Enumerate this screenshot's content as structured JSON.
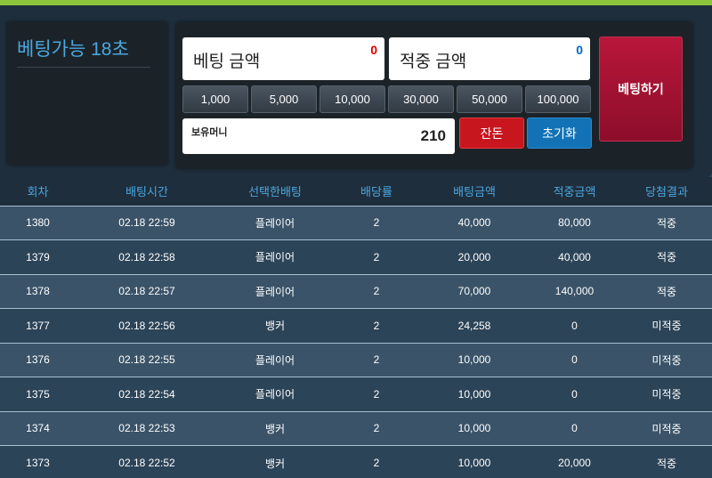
{
  "timer": {
    "label": "베팅가능 18초"
  },
  "bet_amount": {
    "label": "베팅 금액",
    "value": "0",
    "color": "#e00000"
  },
  "win_amount": {
    "label": "적중 금액",
    "value": "0",
    "color": "#0066cc"
  },
  "chips": [
    "1,000",
    "5,000",
    "10,000",
    "30,000",
    "50,000",
    "100,000"
  ],
  "money": {
    "label": "보유머니",
    "value": "210"
  },
  "buttons": {
    "change": "잔돈",
    "reset": "초기화",
    "bet": "베팅하기"
  },
  "table": {
    "headers": [
      "회차",
      "배팅시간",
      "선택한배팅",
      "배당률",
      "배팅금액",
      "적중금액",
      "당첨결과"
    ],
    "rows": [
      {
        "round": "1380",
        "time": "02.18 22:59",
        "choice": "플레이어",
        "odds": "2",
        "bet": "40,000",
        "win": "80,000",
        "result": "적중",
        "status": "win"
      },
      {
        "round": "1379",
        "time": "02.18 22:58",
        "choice": "플레이어",
        "odds": "2",
        "bet": "20,000",
        "win": "40,000",
        "result": "적중",
        "status": "win"
      },
      {
        "round": "1378",
        "time": "02.18 22:57",
        "choice": "플레이어",
        "odds": "2",
        "bet": "70,000",
        "win": "140,000",
        "result": "적중",
        "status": "win"
      },
      {
        "round": "1377",
        "time": "02.18 22:56",
        "choice": "뱅커",
        "odds": "2",
        "bet": "24,258",
        "win": "0",
        "result": "미적중",
        "status": "lose"
      },
      {
        "round": "1376",
        "time": "02.18 22:55",
        "choice": "플레이어",
        "odds": "2",
        "bet": "10,000",
        "win": "0",
        "result": "미적중",
        "status": "lose"
      },
      {
        "round": "1375",
        "time": "02.18 22:54",
        "choice": "플레이어",
        "odds": "2",
        "bet": "10,000",
        "win": "0",
        "result": "미적중",
        "status": "lose"
      },
      {
        "round": "1374",
        "time": "02.18 22:53",
        "choice": "뱅커",
        "odds": "2",
        "bet": "10,000",
        "win": "0",
        "result": "미적중",
        "status": "lose"
      },
      {
        "round": "1373",
        "time": "02.18 22:52",
        "choice": "뱅커",
        "odds": "2",
        "bet": "10,000",
        "win": "20,000",
        "result": "적중",
        "status": "win"
      }
    ]
  }
}
